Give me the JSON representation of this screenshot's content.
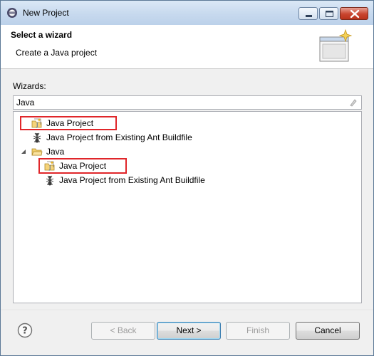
{
  "window": {
    "title": "New Project",
    "minimize_icon": "minimize-icon",
    "maximize_icon": "maximize-icon",
    "close_icon": "close-icon"
  },
  "header": {
    "title": "Select a wizard",
    "description": "Create a Java project",
    "banner_icon": "new-wizard-banner-icon"
  },
  "wizards": {
    "label": "Wizards:",
    "filter_value": "Java",
    "tree": [
      {
        "label": "Java Project",
        "icon": "java-project-icon",
        "highlighted": true
      },
      {
        "label": "Java Project from Existing Ant Buildfile",
        "icon": "ant-icon"
      },
      {
        "label": "Java",
        "icon": "folder-icon",
        "expanded": true,
        "children": [
          {
            "label": "Java Project",
            "icon": "java-project-icon",
            "highlighted": true
          },
          {
            "label": "Java Project from Existing Ant Buildfile",
            "icon": "ant-icon"
          }
        ]
      }
    ]
  },
  "buttons": {
    "back": "< Back",
    "next": "Next >",
    "finish": "Finish",
    "cancel": "Cancel"
  },
  "colors": {
    "highlight_border": "#e0262a",
    "title_bar": "#c7d9ee",
    "link_blue": "#1c5aa9"
  }
}
